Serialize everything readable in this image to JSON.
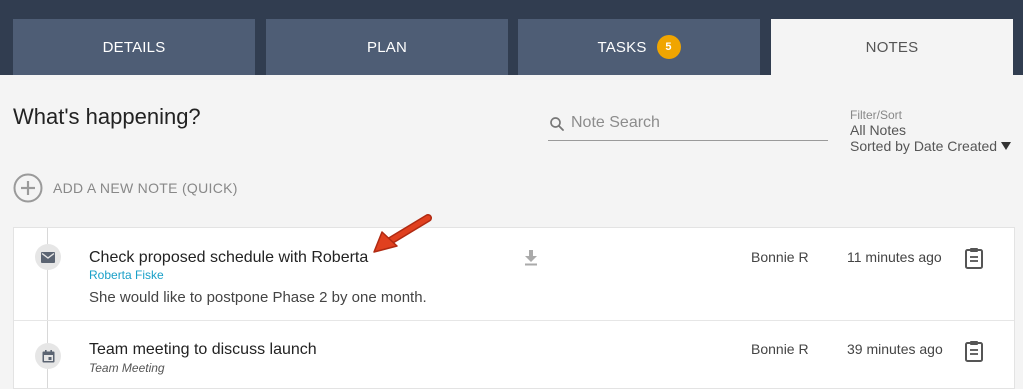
{
  "tabs": [
    {
      "label": "DETAILS"
    },
    {
      "label": "PLAN"
    },
    {
      "label": "TASKS",
      "badge": "5"
    },
    {
      "label": "NOTES",
      "active": true
    }
  ],
  "heading": "What's happening?",
  "search": {
    "placeholder": "Note Search",
    "icon": "search-icon"
  },
  "filter": {
    "label": "Filter/Sort",
    "value1": "All Notes",
    "value2": "Sorted by Date Created"
  },
  "add_note": {
    "label": "ADD A NEW NOTE (QUICK)",
    "icon": "plus-circle-icon"
  },
  "notes": [
    {
      "title": "Check proposed schedule with Roberta",
      "subtitle": "Roberta Fiske",
      "body": "She would like to postpone Phase 2 by one month.",
      "author": "Bonnie R",
      "time": "11 minutes ago",
      "type_icon": "envelope-icon",
      "has_download": true
    },
    {
      "title": "Team meeting to discuss launch",
      "subtitle": "Team Meeting",
      "body": "",
      "author": "Bonnie R",
      "time": "39 minutes ago",
      "type_icon": "calendar-icon",
      "has_download": false
    }
  ],
  "colors": {
    "tab_bar": "#313d50",
    "tab": "#4e5d75",
    "badge": "#f0a500",
    "link": "#1aa0c8",
    "arrow": "#d93a1e"
  }
}
